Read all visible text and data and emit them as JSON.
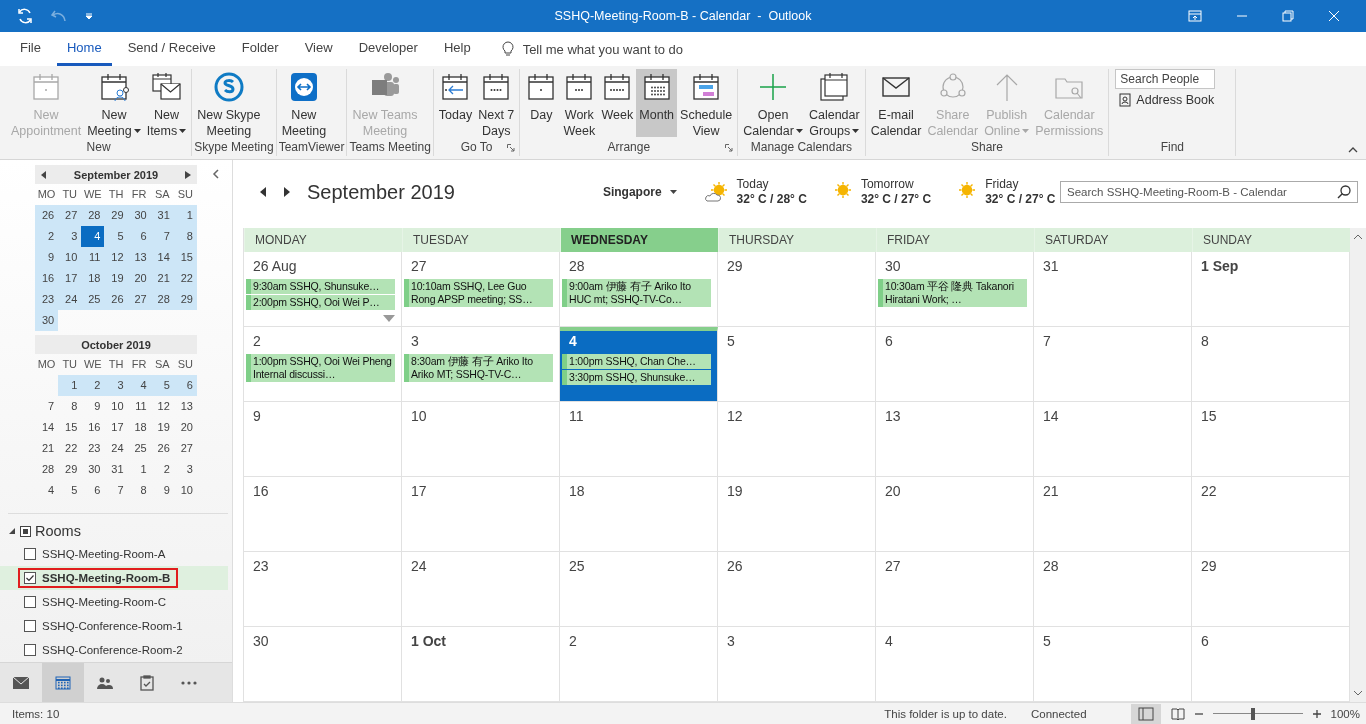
{
  "window": {
    "title": "SSHQ-Meeting-Room-B - Calendar  -  Outlook"
  },
  "menu_tabs": [
    {
      "label": "File",
      "selected": false
    },
    {
      "label": "Home",
      "selected": true
    },
    {
      "label": "Send / Receive",
      "selected": false
    },
    {
      "label": "Folder",
      "selected": false
    },
    {
      "label": "View",
      "selected": false
    },
    {
      "label": "Developer",
      "selected": false
    },
    {
      "label": "Help",
      "selected": false
    }
  ],
  "tell_me": "Tell me what you want to do",
  "ribbon": {
    "groups": [
      {
        "label": "New",
        "launcher": false,
        "buttons": [
          {
            "kind": "appointment",
            "label": [
              "New",
              "Appointment"
            ],
            "disabled": true,
            "dropdown": false
          },
          {
            "kind": "meeting",
            "label": [
              "New",
              "Meeting"
            ],
            "disabled": false,
            "dropdown": true
          },
          {
            "kind": "items",
            "label": [
              "New",
              "Items"
            ],
            "disabled": false,
            "dropdown": true
          }
        ]
      },
      {
        "label": "Skype Meeting",
        "launcher": false,
        "buttons": [
          {
            "kind": "skype",
            "label": [
              "New Skype",
              "Meeting"
            ],
            "disabled": false,
            "dropdown": false
          }
        ]
      },
      {
        "label": "TeamViewer",
        "launcher": false,
        "buttons": [
          {
            "kind": "teamviewer",
            "label": [
              "New",
              "Meeting"
            ],
            "disabled": false,
            "dropdown": false
          }
        ]
      },
      {
        "label": "Teams Meeting",
        "launcher": false,
        "buttons": [
          {
            "kind": "teams",
            "label": [
              "New Teams",
              "Meeting"
            ],
            "disabled": true,
            "dropdown": false
          }
        ]
      },
      {
        "label": "Go To",
        "launcher": true,
        "buttons": [
          {
            "kind": "today",
            "label": [
              "Today"
            ],
            "disabled": false,
            "dropdown": false
          },
          {
            "kind": "next7",
            "label": [
              "Next 7",
              "Days"
            ],
            "disabled": false,
            "dropdown": false
          }
        ]
      },
      {
        "label": "Arrange",
        "launcher": true,
        "buttons": [
          {
            "kind": "day",
            "label": [
              "Day"
            ],
            "disabled": false,
            "selected": false
          },
          {
            "kind": "workweek",
            "label": [
              "Work",
              "Week"
            ],
            "disabled": false,
            "selected": false
          },
          {
            "kind": "week",
            "label": [
              "Week"
            ],
            "disabled": false,
            "selected": false
          },
          {
            "kind": "month",
            "label": [
              "Month"
            ],
            "disabled": false,
            "selected": true
          },
          {
            "kind": "schedule",
            "label": [
              "Schedule",
              "View"
            ],
            "disabled": false,
            "selected": false
          }
        ]
      },
      {
        "label": "Manage Calendars",
        "launcher": false,
        "buttons": [
          {
            "kind": "open",
            "label": [
              "Open",
              "Calendar"
            ],
            "disabled": false,
            "dropdown": true
          },
          {
            "kind": "groups",
            "label": [
              "Calendar",
              "Groups"
            ],
            "disabled": false,
            "dropdown": true
          }
        ]
      },
      {
        "label": "Share",
        "launcher": false,
        "buttons": [
          {
            "kind": "email",
            "label": [
              "E-mail",
              "Calendar"
            ],
            "disabled": false,
            "dropdown": false
          },
          {
            "kind": "share",
            "label": [
              "Share",
              "Calendar"
            ],
            "disabled": true,
            "dropdown": false
          },
          {
            "kind": "publish",
            "label": [
              "Publish",
              "Online"
            ],
            "disabled": true,
            "dropdown": true
          },
          {
            "kind": "permissions",
            "label": [
              "Calendar",
              "Permissions"
            ],
            "disabled": true,
            "dropdown": false
          }
        ]
      }
    ],
    "find": {
      "label": "Find",
      "search_placeholder": "Search People",
      "address_book": "Address Book"
    }
  },
  "mini_calendars": [
    {
      "title": "September 2019",
      "weekdays": [
        "MO",
        "TU",
        "WE",
        "TH",
        "FR",
        "SA",
        "SU"
      ],
      "weeks": [
        [
          {
            "day": "26",
            "in_range": true,
            "selected": false
          },
          {
            "day": "27",
            "in_range": true,
            "selected": false
          },
          {
            "day": "28",
            "in_range": true,
            "selected": false
          },
          {
            "day": "29",
            "in_range": true,
            "selected": false
          },
          {
            "day": "30",
            "in_range": true,
            "selected": false
          },
          {
            "day": "31",
            "in_range": true,
            "selected": false
          },
          {
            "day": "1",
            "in_range": true,
            "selected": false
          }
        ],
        [
          {
            "day": "2",
            "in_range": true,
            "selected": false
          },
          {
            "day": "3",
            "in_range": true,
            "selected": false
          },
          {
            "day": "4",
            "in_range": true,
            "selected": true
          },
          {
            "day": "5",
            "in_range": true,
            "selected": false
          },
          {
            "day": "6",
            "in_range": true,
            "selected": false
          },
          {
            "day": "7",
            "in_range": true,
            "selected": false
          },
          {
            "day": "8",
            "in_range": true,
            "selected": false
          }
        ],
        [
          {
            "day": "9",
            "in_range": true,
            "selected": false
          },
          {
            "day": "10",
            "in_range": true,
            "selected": false
          },
          {
            "day": "11",
            "in_range": true,
            "selected": false
          },
          {
            "day": "12",
            "in_range": true,
            "selected": false
          },
          {
            "day": "13",
            "in_range": true,
            "selected": false
          },
          {
            "day": "14",
            "in_range": true,
            "selected": false
          },
          {
            "day": "15",
            "in_range": true,
            "selected": false
          }
        ],
        [
          {
            "day": "16",
            "in_range": true,
            "selected": false
          },
          {
            "day": "17",
            "in_range": true,
            "selected": false
          },
          {
            "day": "18",
            "in_range": true,
            "selected": false
          },
          {
            "day": "19",
            "in_range": true,
            "selected": false
          },
          {
            "day": "20",
            "in_range": true,
            "selected": false
          },
          {
            "day": "21",
            "in_range": true,
            "selected": false
          },
          {
            "day": "22",
            "in_range": true,
            "selected": false
          }
        ],
        [
          {
            "day": "23",
            "in_range": true,
            "selected": false
          },
          {
            "day": "24",
            "in_range": true,
            "selected": false
          },
          {
            "day": "25",
            "in_range": true,
            "selected": false
          },
          {
            "day": "26",
            "in_range": true,
            "selected": false
          },
          {
            "day": "27",
            "in_range": true,
            "selected": false
          },
          {
            "day": "28",
            "in_range": true,
            "selected": false
          },
          {
            "day": "29",
            "in_range": true,
            "selected": false
          }
        ],
        [
          {
            "day": "30",
            "in_range": true,
            "selected": false
          }
        ]
      ]
    },
    {
      "title": "October 2019",
      "weekdays": [
        "MO",
        "TU",
        "WE",
        "TH",
        "FR",
        "SA",
        "SU"
      ],
      "weeks": [
        [
          {
            "day": "1",
            "in_range": true,
            "selected": false
          },
          {
            "day": "2",
            "in_range": true,
            "selected": false
          },
          {
            "day": "3",
            "in_range": true,
            "selected": false
          },
          {
            "day": "4",
            "in_range": true,
            "selected": false
          },
          {
            "day": "5",
            "in_range": true,
            "selected": false
          },
          {
            "day": "6",
            "in_range": true,
            "selected": false
          }
        ],
        [
          {
            "day": "7",
            "in_range": false,
            "selected": false
          },
          {
            "day": "8",
            "in_range": false,
            "selected": false
          },
          {
            "day": "9",
            "in_range": false,
            "selected": false
          },
          {
            "day": "10",
            "in_range": false,
            "selected": false
          },
          {
            "day": "11",
            "in_range": false,
            "selected": false
          },
          {
            "day": "12",
            "in_range": false,
            "selected": false
          },
          {
            "day": "13",
            "in_range": false,
            "selected": false
          }
        ],
        [
          {
            "day": "14",
            "in_range": false,
            "selected": false
          },
          {
            "day": "15",
            "in_range": false,
            "selected": false
          },
          {
            "day": "16",
            "in_range": false,
            "selected": false
          },
          {
            "day": "17",
            "in_range": false,
            "selected": false
          },
          {
            "day": "18",
            "in_range": false,
            "selected": false
          },
          {
            "day": "19",
            "in_range": false,
            "selected": false
          },
          {
            "day": "20",
            "in_range": false,
            "selected": false
          }
        ],
        [
          {
            "day": "21",
            "in_range": false,
            "selected": false
          },
          {
            "day": "22",
            "in_range": false,
            "selected": false
          },
          {
            "day": "23",
            "in_range": false,
            "selected": false
          },
          {
            "day": "24",
            "in_range": false,
            "selected": false
          },
          {
            "day": "25",
            "in_range": false,
            "selected": false
          },
          {
            "day": "26",
            "in_range": false,
            "selected": false
          },
          {
            "day": "27",
            "in_range": false,
            "selected": false
          }
        ],
        [
          {
            "day": "28",
            "in_range": false,
            "selected": false
          },
          {
            "day": "29",
            "in_range": false,
            "selected": false
          },
          {
            "day": "30",
            "in_range": false,
            "selected": false
          },
          {
            "day": "31",
            "in_range": false,
            "selected": false
          },
          {
            "day": "1",
            "in_range": false,
            "selected": false
          },
          {
            "day": "2",
            "in_range": false,
            "selected": false
          },
          {
            "day": "3",
            "in_range": false,
            "selected": false
          }
        ],
        [
          {
            "day": "4",
            "in_range": false,
            "selected": false
          },
          {
            "day": "5",
            "in_range": false,
            "selected": false
          },
          {
            "day": "6",
            "in_range": false,
            "selected": false
          },
          {
            "day": "7",
            "in_range": false,
            "selected": false
          },
          {
            "day": "8",
            "in_range": false,
            "selected": false
          },
          {
            "day": "9",
            "in_range": false,
            "selected": false
          },
          {
            "day": "10",
            "in_range": false,
            "selected": false
          }
        ]
      ]
    }
  ],
  "rooms": {
    "label": "Rooms",
    "expanded": true,
    "items": [
      {
        "name": "SSHQ-Meeting-Room-A",
        "checked": false,
        "selected": false,
        "annotated": false
      },
      {
        "name": "SSHQ-Meeting-Room-B",
        "checked": true,
        "selected": true,
        "annotated": true
      },
      {
        "name": "SSHQ-Meeting-Room-C",
        "checked": false,
        "selected": false,
        "annotated": false
      },
      {
        "name": "SSHQ-Conference-Room-1",
        "checked": false,
        "selected": false,
        "annotated": false
      },
      {
        "name": "SSHQ-Conference-Room-2",
        "checked": false,
        "selected": false,
        "annotated": false
      }
    ]
  },
  "nav": [
    {
      "kind": "mail",
      "selected": false
    },
    {
      "kind": "calendar",
      "selected": true
    },
    {
      "kind": "people",
      "selected": false
    },
    {
      "kind": "tasks",
      "selected": false
    },
    {
      "kind": "more",
      "selected": false
    }
  ],
  "calendar": {
    "title": "September 2019",
    "location": "Singapore",
    "weather": [
      {
        "day": "Today",
        "temp": "32° C / 28° C",
        "kind": "partly-sunny"
      },
      {
        "day": "Tomorrow",
        "temp": "32° C / 27° C",
        "kind": "sunny"
      },
      {
        "day": "Friday",
        "temp": "32° C / 27° C",
        "kind": "sunny"
      }
    ],
    "search_placeholder": "Search SSHQ-Meeting-Room-B - Calendar",
    "columns": [
      {
        "label": "MONDAY",
        "selected": false
      },
      {
        "label": "TUESDAY",
        "selected": false
      },
      {
        "label": "WEDNESDAY",
        "selected": true
      },
      {
        "label": "THURSDAY",
        "selected": false
      },
      {
        "label": "FRIDAY",
        "selected": false
      },
      {
        "label": "SATURDAY",
        "selected": false
      },
      {
        "label": "SUNDAY",
        "selected": false
      }
    ],
    "weeks": [
      [
        {
          "day": "26 Aug",
          "bold": false,
          "today": false,
          "more": true,
          "events": [
            "9:30am SSHQ, Shunsuke…",
            "2:00pm SSHQ, Ooi Wei P…"
          ]
        },
        {
          "day": "27",
          "bold": false,
          "today": false,
          "events": [
            "10:10am SSHQ, Lee Guo Rong APSP meeting; SS…"
          ]
        },
        {
          "day": "28",
          "bold": false,
          "today": false,
          "events": [
            "9:00am 伊藤 有子 Ariko Ito HUC mt; SSHQ-TV-Co…"
          ]
        },
        {
          "day": "29",
          "bold": false,
          "today": false
        },
        {
          "day": "30",
          "bold": false,
          "today": false,
          "events": [
            "10:30am 平谷 隆典 Takanori Hiratani Work; …"
          ]
        },
        {
          "day": "31",
          "bold": false,
          "today": false
        },
        {
          "day": "1 Sep",
          "bold": true,
          "today": false
        }
      ],
      [
        {
          "day": "2",
          "bold": false,
          "today": false,
          "events": [
            "1:00pm SSHQ, Ooi Wei Pheng Internal discussi…"
          ]
        },
        {
          "day": "3",
          "bold": false,
          "today": false,
          "events": [
            "8:30am 伊藤 有子 Ariko Ito Ariko MT; SSHQ-TV-C…"
          ]
        },
        {
          "day": "4",
          "bold": true,
          "today": true,
          "events": [
            "1:00pm SSHQ, Chan Che…",
            "3:30pm SSHQ, Shunsuke…"
          ]
        },
        {
          "day": "5",
          "bold": false,
          "today": false
        },
        {
          "day": "6",
          "bold": false,
          "today": false
        },
        {
          "day": "7",
          "bold": false,
          "today": false
        },
        {
          "day": "8",
          "bold": false,
          "today": false
        }
      ],
      [
        {
          "day": "9",
          "bold": false,
          "today": false
        },
        {
          "day": "10",
          "bold": false,
          "today": false
        },
        {
          "day": "11",
          "bold": false,
          "today": false
        },
        {
          "day": "12",
          "bold": false,
          "today": false
        },
        {
          "day": "13",
          "bold": false,
          "today": false
        },
        {
          "day": "14",
          "bold": false,
          "today": false
        },
        {
          "day": "15",
          "bold": false,
          "today": false
        }
      ],
      [
        {
          "day": "16",
          "bold": false,
          "today": false
        },
        {
          "day": "17",
          "bold": false,
          "today": false
        },
        {
          "day": "18",
          "bold": false,
          "today": false
        },
        {
          "day": "19",
          "bold": false,
          "today": false
        },
        {
          "day": "20",
          "bold": false,
          "today": false
        },
        {
          "day": "21",
          "bold": false,
          "today": false
        },
        {
          "day": "22",
          "bold": false,
          "today": false
        }
      ],
      [
        {
          "day": "23",
          "bold": false,
          "today": false
        },
        {
          "day": "24",
          "bold": false,
          "today": false
        },
        {
          "day": "25",
          "bold": false,
          "today": false
        },
        {
          "day": "26",
          "bold": false,
          "today": false
        },
        {
          "day": "27",
          "bold": false,
          "today": false
        },
        {
          "day": "28",
          "bold": false,
          "today": false
        },
        {
          "day": "29",
          "bold": false,
          "today": false
        }
      ],
      [
        {
          "day": "30",
          "bold": false,
          "today": false
        },
        {
          "day": "1 Oct",
          "bold": true,
          "today": false
        },
        {
          "day": "2",
          "bold": false,
          "today": false
        },
        {
          "day": "3",
          "bold": false,
          "today": false
        },
        {
          "day": "4",
          "bold": false,
          "today": false
        },
        {
          "day": "5",
          "bold": false,
          "today": false
        },
        {
          "day": "6",
          "bold": false,
          "today": false
        }
      ]
    ]
  },
  "status_bar": {
    "items": "Items: 10",
    "sync": "This folder is up to date.",
    "connection": "Connected",
    "zoom": "100%",
    "zoom_slider": {
      "level": 0.45
    }
  }
}
